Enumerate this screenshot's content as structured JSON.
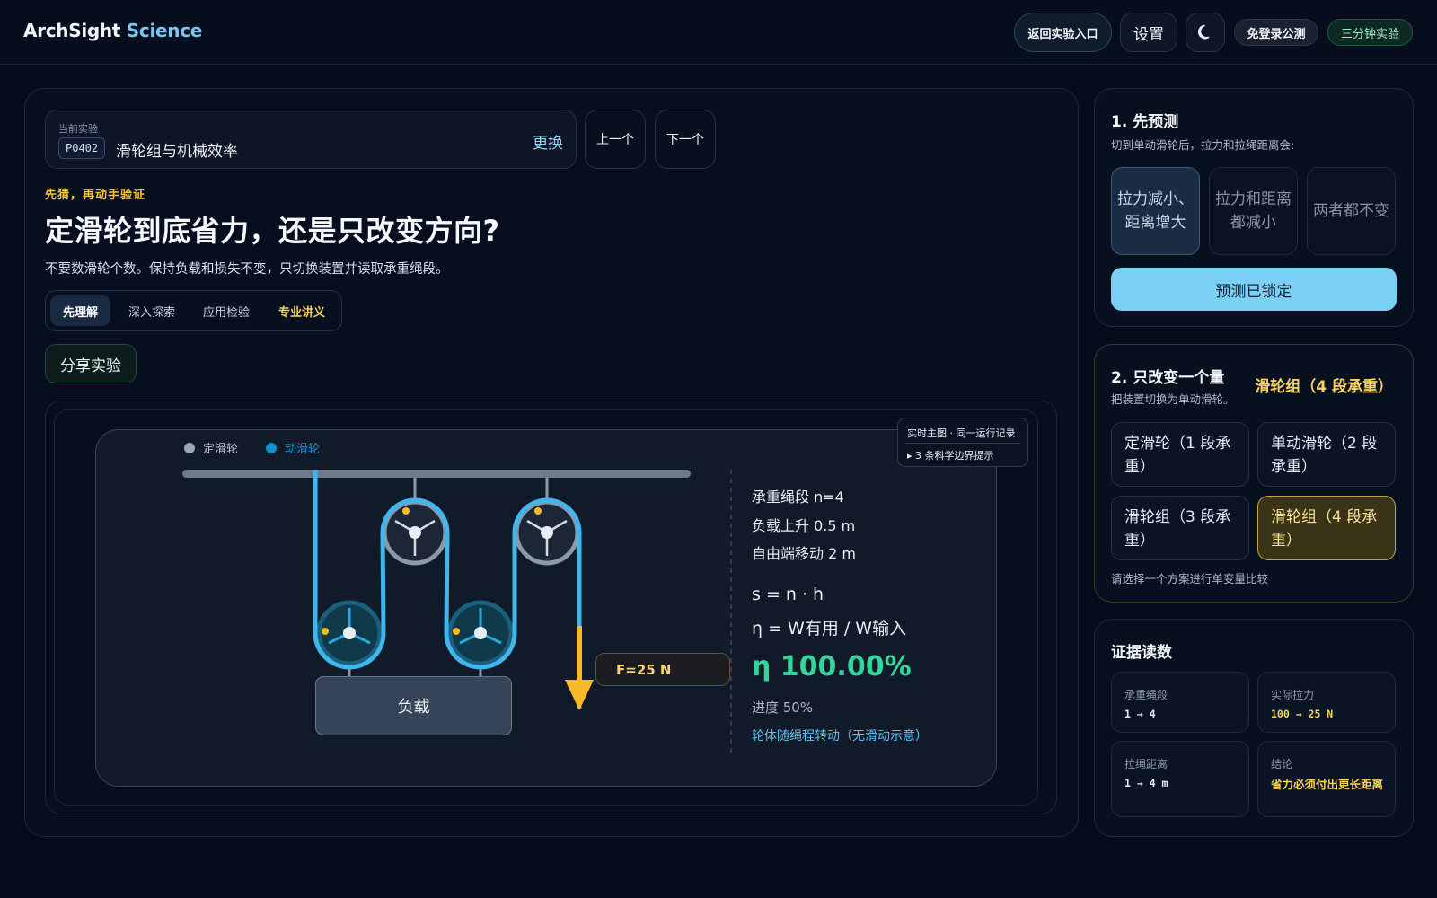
{
  "header": {
    "brand_a": "ArchSight",
    "brand_b": "Science",
    "return_label": "返回实验入口",
    "settings_label": "设置",
    "free_label": "免登录公测",
    "three_label": "三分钟实验"
  },
  "experiment": {
    "caption": "当前实验",
    "code": "P0402",
    "name": "滑轮组与机械效率",
    "swap_label": "更换",
    "prev_label": "上一个",
    "next_label": "下一个"
  },
  "intro": {
    "kicker": "先猜，再动手验证",
    "title": "定滑轮到底省力，还是只改变方向?",
    "subtitle": "不要数滑轮个数。保持负载和损失不变，只切换装置并读取承重绳段。"
  },
  "tabs": [
    "先理解",
    "深入探索",
    "应用检验",
    "专业讲义"
  ],
  "share_label": "分享实验",
  "stage": {
    "legend_fixed": "定滑轮",
    "legend_moving": "动滑轮",
    "live_title": "实时主图 · 同一运行记录",
    "live_hint": "▸ 3 条科学边界提示",
    "force": "F=25 N",
    "load": "负载",
    "segments": "承重绳段 n=4",
    "rise": "负载上升 0.5 m",
    "free_end": "自由端移动 2 m",
    "formula_s": "s = n · h",
    "formula_eta": "η = W有用 / W输入",
    "efficiency": "η 100.00%",
    "progress_text": "进度 50%",
    "note": "轮体随绳程转动（无滑动示意）"
  },
  "colors": {
    "rope": "#3fb6ec",
    "fixed_pulley": "#8a98ab",
    "force_arrow": "#f7b928",
    "efficiency": "#33d69a",
    "accent": "#7cd0f5",
    "gold": "#f4d35e"
  },
  "predict": {
    "heading": "1. 先预测",
    "prompt": "切到单动滑轮后，拉力和拉绳距离会:",
    "options": [
      "拉力减小、距离增大",
      "拉力和距离都减小",
      "两者都不变"
    ],
    "selected": 0,
    "locked_label": "预测已锁定"
  },
  "change": {
    "heading": "2. 只改变一个量",
    "sub": "把装置切换为单动滑轮。",
    "badge": "滑轮组（4 段承重）",
    "options": [
      "定滑轮（1 段承重）",
      "单动滑轮（2 段承重）",
      "滑轮组（3 段承重）",
      "滑轮组（4 段承重）"
    ],
    "selected": 3,
    "hint": "请选择一个方案进行单变量比较"
  },
  "evidence": {
    "heading": "证据读数",
    "items": [
      {
        "key": "承重绳段",
        "value": "1 → 4"
      },
      {
        "key": "实际拉力",
        "value": "100 → 25 N"
      },
      {
        "key": "拉绳距离",
        "value": "1 → 4 m"
      },
      {
        "key": "结论",
        "value": "省力必须付出更长距离"
      }
    ]
  }
}
